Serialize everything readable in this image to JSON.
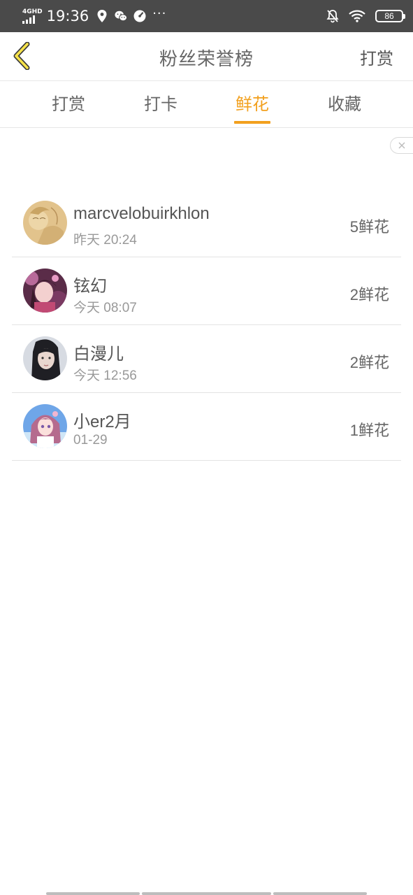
{
  "status_bar": {
    "network": "4GHD",
    "time": "19:36",
    "dots": "···",
    "battery": "86",
    "icons": [
      "location-pin-icon",
      "wechat-icon",
      "speedometer-icon",
      "notification-off-icon",
      "wifi-icon",
      "battery-icon"
    ]
  },
  "header": {
    "title": "粉丝荣誉榜",
    "action_label": "打赏",
    "back_icon": "chevron-left-icon"
  },
  "tabs": [
    {
      "label": "打赏",
      "active": false
    },
    {
      "label": "打卡",
      "active": false
    },
    {
      "label": "鲜花",
      "active": true
    },
    {
      "label": "收藏",
      "active": false
    }
  ],
  "accent_color": "#f2a01e",
  "list": [
    {
      "name": "marcvelobuirkhlon",
      "time": "昨天 20:24",
      "count": "5鲜花"
    },
    {
      "name": "铉幻",
      "time": "今天 08:07",
      "count": "2鲜花"
    },
    {
      "name": "白漫儿",
      "time": "今天 12:56",
      "count": "2鲜花"
    },
    {
      "name": "小er2月",
      "time": "01-29",
      "count": "1鲜花"
    }
  ]
}
